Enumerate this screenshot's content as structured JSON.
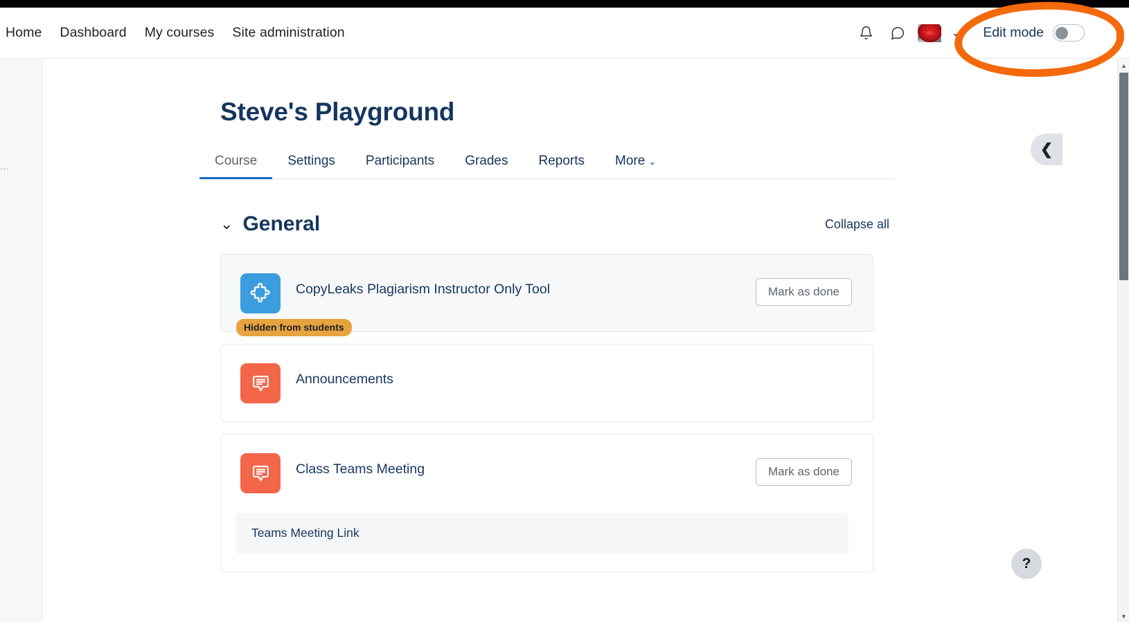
{
  "browser": {
    "scrollbar": {
      "up_arrow": "▲",
      "down_arrow": "▼"
    }
  },
  "navbar": {
    "links": [
      {
        "label": "Home",
        "name": "nav-home"
      },
      {
        "label": "Dashboard",
        "name": "nav-dashboard"
      },
      {
        "label": "My courses",
        "name": "nav-my-courses"
      },
      {
        "label": "Site administration",
        "name": "nav-site-administration"
      }
    ],
    "notifications_icon": "bell-icon",
    "messages_icon": "message-bubble-icon",
    "user_menu_caret": "⌄",
    "edit_mode": {
      "label": "Edit mode",
      "state": "off"
    }
  },
  "annotation": {
    "shape": "hand-drawn-ellipse",
    "color": "#f4690b",
    "target": "Edit mode toggle"
  },
  "left_drawer": {
    "truncated_text": "..."
  },
  "course": {
    "title": "Steve's Playground",
    "tabs": [
      {
        "label": "Course",
        "active": true
      },
      {
        "label": "Settings",
        "active": false
      },
      {
        "label": "Participants",
        "active": false
      },
      {
        "label": "Grades",
        "active": false
      },
      {
        "label": "Reports",
        "active": false
      },
      {
        "label": "More",
        "active": false,
        "caret": "⌄"
      }
    ],
    "section": {
      "chevron": "⌄",
      "title": "General",
      "collapse_all": "Collapse all"
    },
    "activities": [
      {
        "name": "CopyLeaks Plagiarism Instructor Only Tool",
        "icon": "puzzle-piece-icon",
        "icon_color": "#3b9ddd",
        "badge": "Hidden from students",
        "badge_color": "#e7a33e",
        "completion_button": "Mark as done",
        "dimmed": true,
        "description": null
      },
      {
        "name": "Announcements",
        "icon": "forum-bubble-icon",
        "icon_color": "#f4664a",
        "badge": null,
        "completion_button": null,
        "dimmed": false,
        "description": null
      },
      {
        "name": "Class Teams Meeting",
        "icon": "forum-bubble-icon",
        "icon_color": "#f4664a",
        "badge": null,
        "completion_button": "Mark as done",
        "dimmed": false,
        "description": "Teams Meeting Link"
      }
    ]
  },
  "drawer_toggle": {
    "icon": "chevron-left-icon",
    "glyph": "❮"
  },
  "help": {
    "glyph": "?"
  }
}
